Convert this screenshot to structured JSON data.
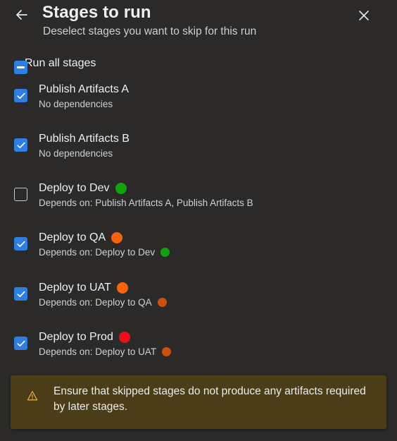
{
  "header": {
    "title": "Stages to run",
    "subtitle": "Deselect stages you want to skip for this run"
  },
  "run_all": {
    "label": "Run all stages",
    "state": "indeterminate"
  },
  "stages": [
    {
      "name": "Publish Artifacts A",
      "deps": "No dependencies",
      "checked": true
    },
    {
      "name": "Publish Artifacts B",
      "deps": "No dependencies",
      "checked": true
    },
    {
      "name": "Deploy to Dev",
      "deps": "Depends on: Publish Artifacts A, Publish Artifacts B",
      "checked": false,
      "status_color": "#13a10e"
    },
    {
      "name": "Deploy to QA",
      "deps": "Depends on: Deploy to Dev",
      "checked": true,
      "status_color": "#f7630c",
      "dep_status_color": "#13a10e"
    },
    {
      "name": "Deploy to UAT",
      "deps": "Depends on: Deploy to QA",
      "checked": true,
      "status_color": "#f7630c",
      "dep_status_color": "#ca5010"
    },
    {
      "name": "Deploy to Prod",
      "deps": "Depends on: Deploy to UAT",
      "checked": true,
      "status_color": "#e81123",
      "dep_status_color": "#ca5010"
    }
  ],
  "warning": {
    "icon": "warning-icon",
    "text": "Ensure that skipped stages do not produce any artifacts required by later stages."
  },
  "colors": {
    "background": "#2b2a29",
    "accent": "#2f7fe0",
    "warning_bg": "#4a3d17",
    "warning_icon": "#e8a33d"
  }
}
